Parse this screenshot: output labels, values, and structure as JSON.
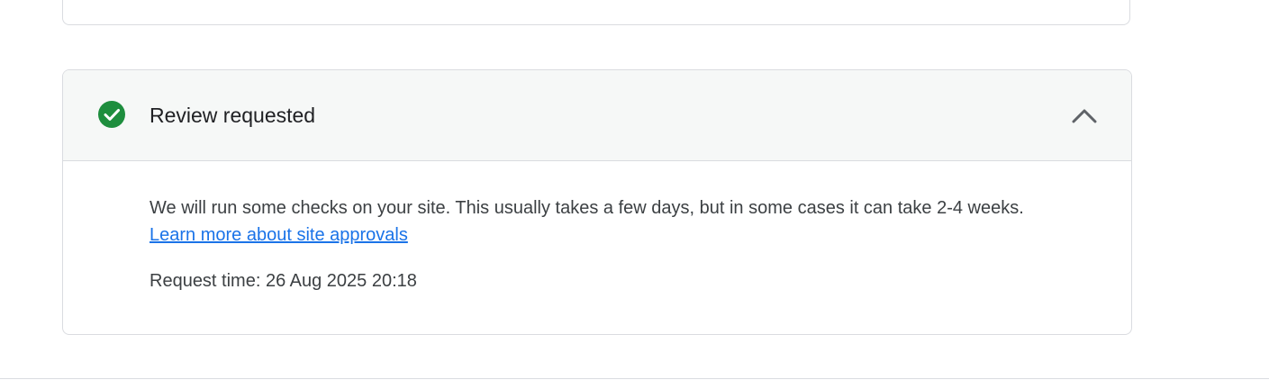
{
  "review_card": {
    "title": "Review requested",
    "status_icon": "check-circle-icon",
    "status_color": "#1e8e3e",
    "collapse_icon": "chevron-up-icon",
    "description": "We will run some checks on your site. This usually takes a few days, but in some cases it can take 2-4 weeks.",
    "learn_more_link": "Learn more about site approvals",
    "request_time_label": "Request time:",
    "request_time_value": "26 Aug 2025 20:18"
  },
  "colors": {
    "header_background": "#f6f8f7",
    "link": "#1a73e8",
    "border": "#dadce0"
  }
}
